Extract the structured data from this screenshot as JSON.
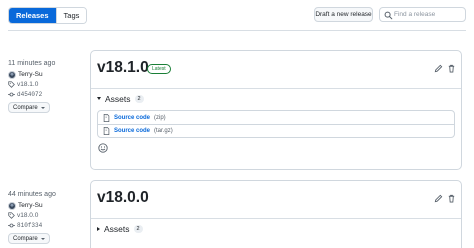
{
  "header": {
    "tabs": [
      {
        "label": "Releases",
        "active": true
      },
      {
        "label": "Tags",
        "active": false
      }
    ],
    "draft_button": "Draft a new release",
    "search_placeholder": "Find a release"
  },
  "releases": [
    {
      "time_ago": "11 minutes ago",
      "author": "Terry-Su",
      "tag": "v18.1.0",
      "commit": "d454072",
      "compare_label": "Compare",
      "title": "v18.1.0",
      "badge": "Latest",
      "assets_label": "Assets",
      "assets_count": "2",
      "assets_expanded": true,
      "assets": [
        {
          "name": "Source code",
          "format": "(zip)"
        },
        {
          "name": "Source code",
          "format": "(tar.gz)"
        }
      ]
    },
    {
      "time_ago": "44 minutes ago",
      "author": "Terry-Su",
      "tag": "v18.0.0",
      "commit": "810f334",
      "compare_label": "Compare",
      "title": "v18.0.0",
      "assets_label": "Assets",
      "assets_count": "2",
      "assets_expanded": false
    }
  ],
  "colors": {
    "accent": "#0969da",
    "latest_badge": "#1a7f37",
    "border": "#d0d7de"
  },
  "icons": [
    "search-icon",
    "tag-icon",
    "commit-icon",
    "avatar",
    "pencil-icon",
    "trash-icon",
    "zip-file-icon",
    "smiley-icon"
  ]
}
